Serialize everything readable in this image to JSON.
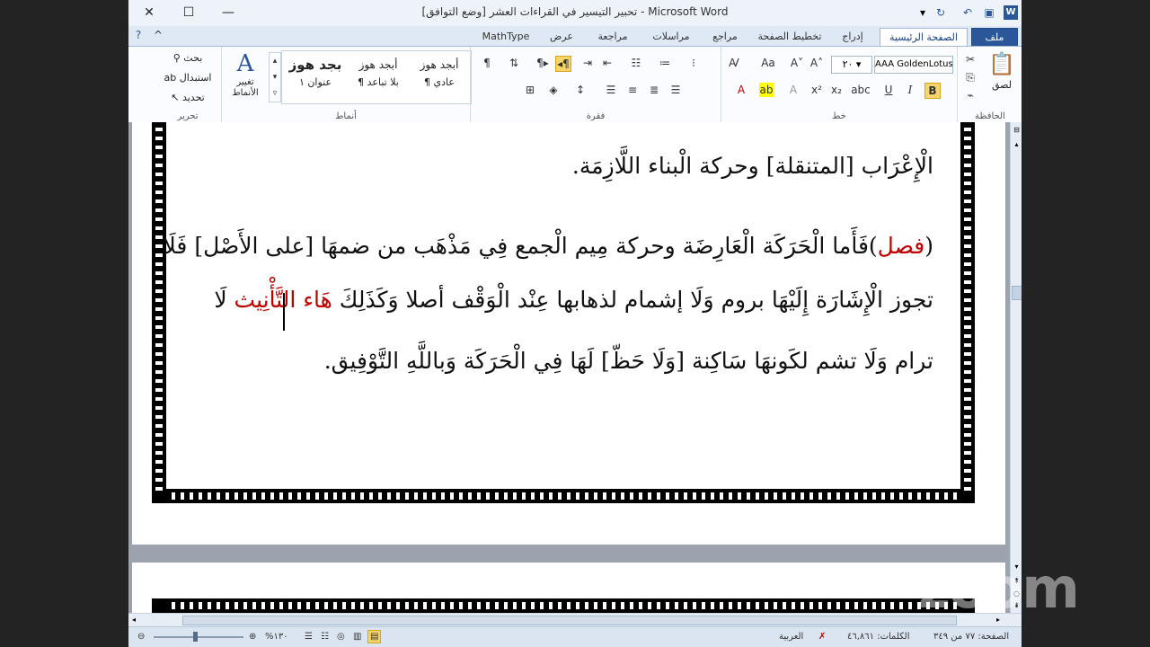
{
  "window": {
    "title": "تحبير التيسير في القراءات العشر [وضع التوافق] - Microsoft Word",
    "app_icon": "W"
  },
  "tabs": [
    {
      "label": "ملف"
    },
    {
      "label": "الصفحة الرئيسية"
    },
    {
      "label": "إدراج"
    },
    {
      "label": "تخطيط الصفحة"
    },
    {
      "label": "مراجع"
    },
    {
      "label": "مراسلات"
    },
    {
      "label": "مراجعة"
    },
    {
      "label": "عرض"
    },
    {
      "label": "MathType"
    }
  ],
  "ribbon": {
    "clipboard": {
      "label": "الحافظة",
      "paste": "لصق"
    },
    "font": {
      "label": "خط",
      "font_name": "AAA GoldenLotus",
      "font_size": "٢٠"
    },
    "paragraph": {
      "label": "فقرة"
    },
    "styles": {
      "label": "أنماط",
      "items": [
        {
          "preview": "أبجد هوز",
          "name": "¶ عادي"
        },
        {
          "preview": "أبجد هوز",
          "name": "¶ بلا تباعد"
        },
        {
          "preview": "بجد هوز",
          "name": "عنوان ١"
        }
      ],
      "change_styles": "تغيير الأنماط"
    },
    "editing": {
      "label": "تحرير",
      "find": "بحث",
      "replace": "استبدال",
      "select": "تحديد"
    }
  },
  "document": {
    "lines": [
      {
        "segments": [
          {
            "text": "الْإِعْرَاب [المتنقلة] وحركة الْبناء اللَّازِمَة.",
            "color": "#111111"
          }
        ]
      },
      {
        "segments": [
          {
            "text": "(",
            "color": "#111111"
          },
          {
            "text": "فصل",
            "color": "#c00000"
          },
          {
            "text": ")فَأَما الْحَرَكَة الْعَارِضَة وحركة مِيم الْجمع فِي مَذْهَب من ضمهَا [على الأَصْل] فَلَا",
            "color": "#111111"
          }
        ]
      },
      {
        "segments": [
          {
            "text": "تجوز الْإِشَارَة إِلَيْهَا بروم وَلَا إشمام لذهابها عِنْد الْوَقْف أصلا وَكَذَلِكَ ",
            "color": "#111111"
          },
          {
            "text": "هَاء التَّأْنِيث",
            "color": "#c00000"
          },
          {
            "text": " لَا",
            "color": "#111111"
          }
        ]
      },
      {
        "segments": [
          {
            "text": "ترام وَلَا تشم لكَونهَا سَاكِنة [وَلَا حَظّ] لَهَا فِي الْحَرَكَة وَباللَّهِ التَّوْفِيق.",
            "color": "#111111"
          }
        ]
      }
    ]
  },
  "statusbar": {
    "page": "الصفحة: ٧٧ من ٣٤٩",
    "words": "الكلمات: ٤٦,٨٦١",
    "language": "العربية",
    "zoom": "%١٣٠"
  },
  "watermark": "zoom"
}
